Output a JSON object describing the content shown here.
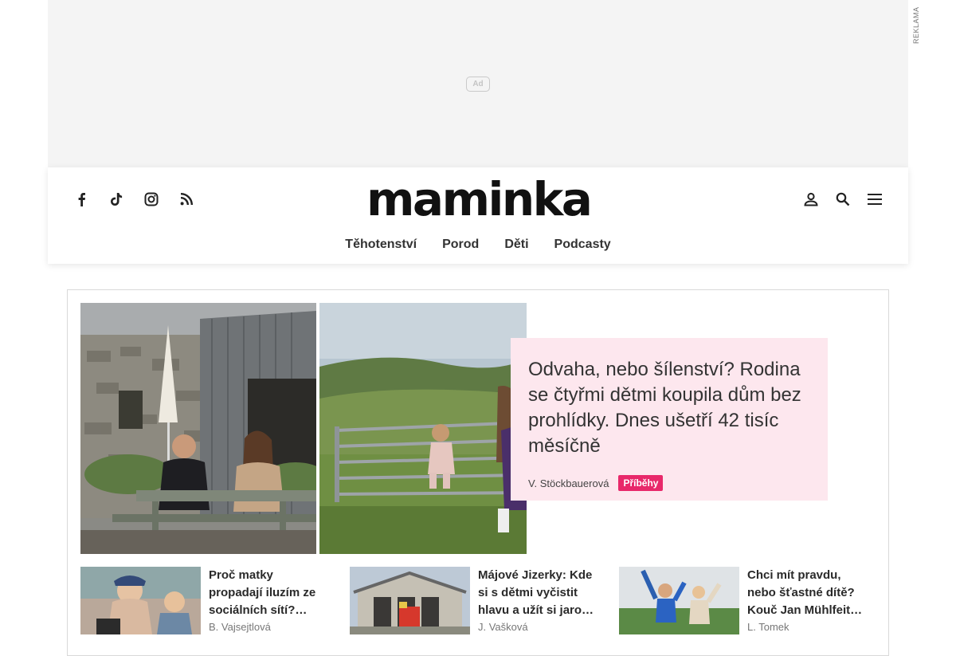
{
  "ad": {
    "badge": "Ad",
    "label": "REKLAMA"
  },
  "header": {
    "logo": "maminka",
    "social_icons": [
      "facebook-icon",
      "tiktok-icon",
      "instagram-icon",
      "rss-icon"
    ],
    "tool_icons": [
      "user-icon",
      "search-icon",
      "menu-icon"
    ],
    "nav": [
      "Těhotenství",
      "Porod",
      "Děti",
      "Podcasty"
    ]
  },
  "hero": {
    "title": "Odvaha, nebo šílenství? Rodina se čtyřmi dětmi koupila dům bez prohlídky. Dnes ušetří 42 tisíc měsíčně",
    "author": "V. Stöckbauerová",
    "tag": "Příběhy",
    "card_bg": "#fde7ee",
    "tag_color": "#e8286a"
  },
  "articles": [
    {
      "title": "Proč matky propadají iluzím ze sociálních sítí? Psycholožka vysvětluje",
      "author": "B. Vajsejtlová"
    },
    {
      "title": "Májové Jizerky: Kde si s dětmi vyčistit hlavu a užít si jaro naplno",
      "author": "J. Vašková"
    },
    {
      "title": "Chci mít pravdu, nebo šťastné dítě? Kouč Jan Mühlfeit radí rodičům",
      "author": "L. Tomek"
    }
  ]
}
